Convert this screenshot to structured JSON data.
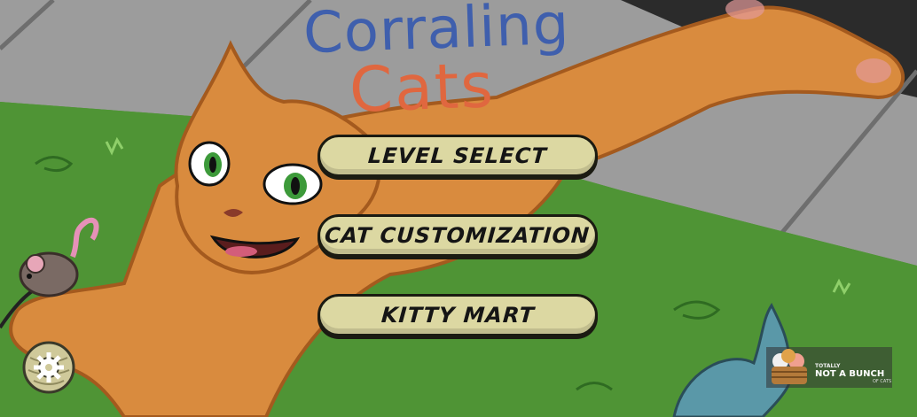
{
  "title": {
    "line1": "Corraling",
    "line2": "Cats"
  },
  "menu": {
    "level_select": "LEVEL SELECT",
    "cat_customization": "CAT CUSTOMIZATION",
    "kitty_mart": "KITTY MART"
  },
  "studio_logo": {
    "line1": "TOTALLY",
    "line2": "NOT A BUNCH",
    "line3": "OF CATS"
  },
  "icons": {
    "settings": "gear-icon",
    "mouse": "toy-mouse-icon",
    "fish": "toy-fish-icon",
    "yarn": "yarn-ball-icon"
  },
  "colors": {
    "grass": "#4f9435",
    "sidewalk": "#9c9c9c",
    "cat": "#d98b3e",
    "button_fill": "#dcd8a2",
    "title_blue": "#3f5fad",
    "title_orange": "#e0673f"
  }
}
